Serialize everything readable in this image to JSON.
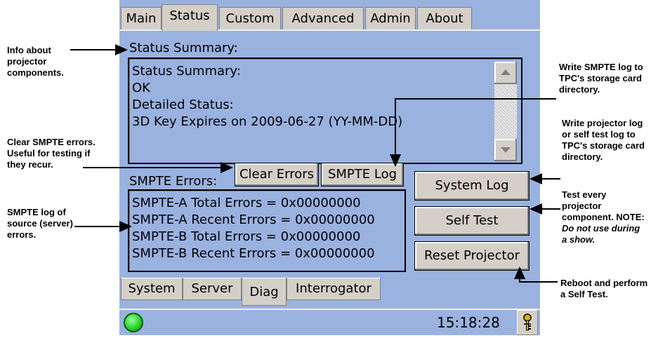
{
  "tabs": [
    "Main",
    "Status",
    "Custom",
    "Advanced",
    "Admin",
    "About"
  ],
  "active_tab": "Status",
  "status_summary": {
    "label": "Status Summary:",
    "lines": [
      "Status Summary:",
      "OK",
      "Detailed Status:",
      "3D Key Expires on 2009-06-27 (YY-MM-DD)"
    ]
  },
  "smpte": {
    "label": "SMPTE Errors:",
    "clear_button": "Clear Errors",
    "log_button": "SMPTE Log",
    "lines": [
      "SMPTE-A Total Errors = 0x00000000",
      "SMPTE-A Recent Errors = 0x00000000",
      "SMPTE-B Total Errors = 0x00000000",
      "SMPTE-B Recent Errors = 0x00000000"
    ]
  },
  "right_buttons": {
    "system_log": "System Log",
    "self_test": "Self Test",
    "reset_projector": "Reset Projector"
  },
  "bottom_tabs": [
    "System",
    "Server",
    "Diag",
    "Interrogator"
  ],
  "active_bottom_tab": "Diag",
  "statusbar": {
    "time": "15:18:28",
    "status_color": "#2bd42b"
  },
  "annotations": {
    "info_components": "Info about projector components.",
    "clear_smpte": "Clear SMPTE errors. Useful for testing if they recur.",
    "smpte_log_source": "SMPTE log of source (server) errors.",
    "write_smpte_log": "Write SMPTE log to TPC's storage card directory.",
    "write_projector_log": "Write projector log or self test log to TPC's storage card directory.",
    "test_every": "Test every projector component.",
    "note_prefix": "NOTE:",
    "note_text": "Do not use during a show.",
    "reboot": "Reboot and perform a Self Test."
  }
}
